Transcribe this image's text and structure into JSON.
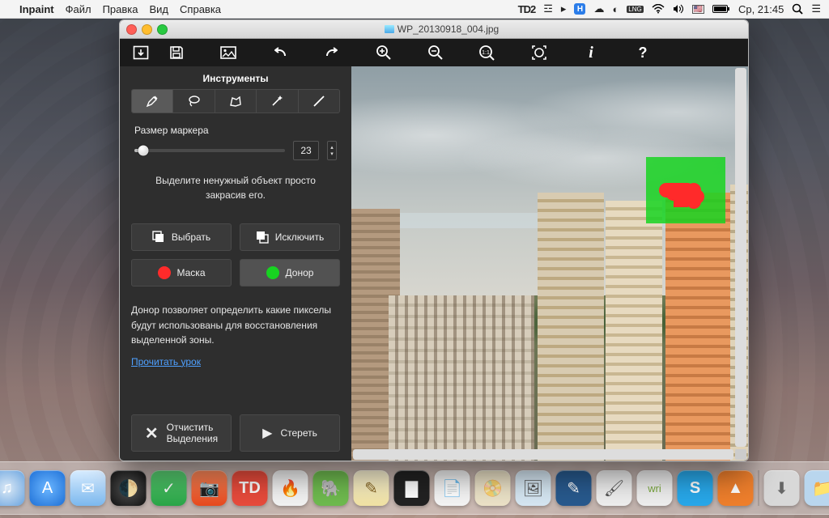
{
  "menubar": {
    "app": "Inpaint",
    "items": [
      "Файл",
      "Правка",
      "Вид",
      "Справка"
    ],
    "right": {
      "td_badge": "2",
      "lang_flag": "LNG",
      "region_flag": "US",
      "clock": "Ср, 21:45"
    }
  },
  "window": {
    "filename": "WP_20130918_004.jpg"
  },
  "sidebar": {
    "tools_header": "Инструменты",
    "marker_size_label": "Размер маркера",
    "marker_size_value": "23",
    "hint1": "Выделите ненужный объект просто закрасив его.",
    "select_btn": "Выбрать",
    "exclude_btn": "Исключить",
    "mask_btn": "Маска",
    "donor_btn": "Донор",
    "donor_desc": "Донор позволяет определить какие пикселы будут использованы для восстановления выделенной зоны.",
    "read_lesson": "Прочитать урок",
    "clear_selection": "Отчистить Выделения",
    "erase": "Стереть"
  },
  "colors": {
    "mask": "#ff2a2a",
    "donor": "#17d321",
    "link": "#4ea0ff"
  }
}
